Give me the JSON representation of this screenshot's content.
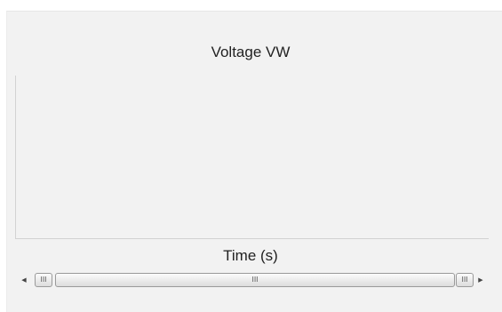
{
  "chart": {
    "title": "Voltage VW",
    "xlabel": "Time (s)"
  },
  "scrollbar": {
    "left_arrow_icon": "arrow-left-icon",
    "right_arrow_icon": "arrow-right-icon",
    "grip_glyph": "III"
  },
  "chart_data": {
    "type": "line",
    "title": "Voltage VW",
    "xlabel": "Time (s)",
    "ylabel": "",
    "series": [],
    "grid": false
  }
}
